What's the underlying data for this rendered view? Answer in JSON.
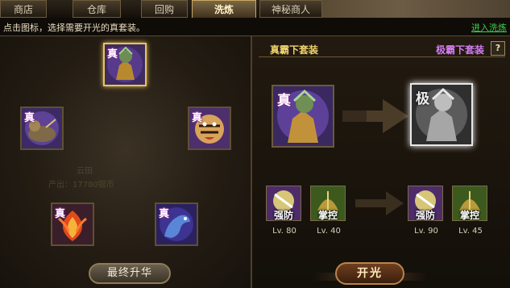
{
  "tabs": [
    "商店",
    "仓库",
    "回购",
    "洗炼",
    "神秘商人"
  ],
  "active_tab": "洗炼",
  "hint": "点击图标，选择需要开光的真套装。",
  "enter_link": "进入洗炼",
  "left": {
    "set_tag": "真",
    "faded_text": [
      "云田",
      "产出：17780银币"
    ],
    "final_button": "最终升华"
  },
  "right": {
    "current_title": "真霸下套装",
    "target_title": "极霸下套装",
    "help": "?",
    "current_tag": "真",
    "target_tag": "极",
    "skills_before": [
      {
        "name": "强防",
        "level": "Lv. 80"
      },
      {
        "name": "掌控",
        "level": "Lv. 40"
      }
    ],
    "skills_after": [
      {
        "name": "强防",
        "level": "Lv. 90"
      },
      {
        "name": "掌控",
        "level": "Lv. 45"
      }
    ],
    "open_button": "开光"
  },
  "colors": {
    "accent": "#f0d36b",
    "target": "#d17cf0",
    "link": "#39d34a"
  }
}
